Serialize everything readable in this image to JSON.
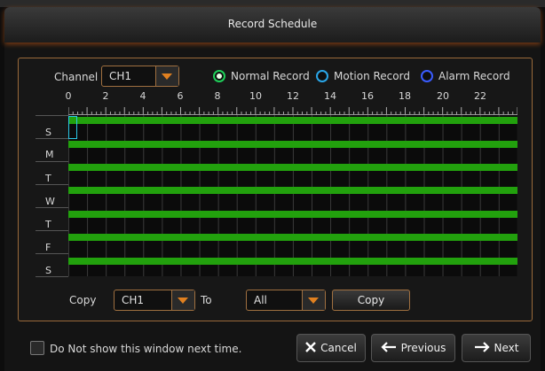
{
  "dialog": {
    "title": "Record Schedule"
  },
  "channel": {
    "label": "Channel",
    "value": "CH1"
  },
  "legend": [
    {
      "label": "Normal Record",
      "selected": true,
      "color": "#1fd05a"
    },
    {
      "label": "Motion Record",
      "selected": false,
      "color": "#2aa6e8"
    },
    {
      "label": "Alarm Record",
      "selected": false,
      "color": "#3a5cff"
    }
  ],
  "schedule": {
    "hours": [
      "0",
      "2",
      "4",
      "6",
      "8",
      "10",
      "12",
      "14",
      "16",
      "18",
      "20",
      "22"
    ],
    "days": [
      "S",
      "M",
      "T",
      "W",
      "T",
      "F",
      "S"
    ],
    "fill_color": "#22a10d"
  },
  "copy_row": {
    "copy_label": "Copy",
    "from_value": "CH1",
    "to_label": "To",
    "to_value": "All",
    "copy_button": "Copy"
  },
  "footer": {
    "dont_show_label": "Do Not show this window next time.",
    "cancel_label": "Cancel",
    "previous_label": "Previous",
    "next_label": "Next"
  }
}
